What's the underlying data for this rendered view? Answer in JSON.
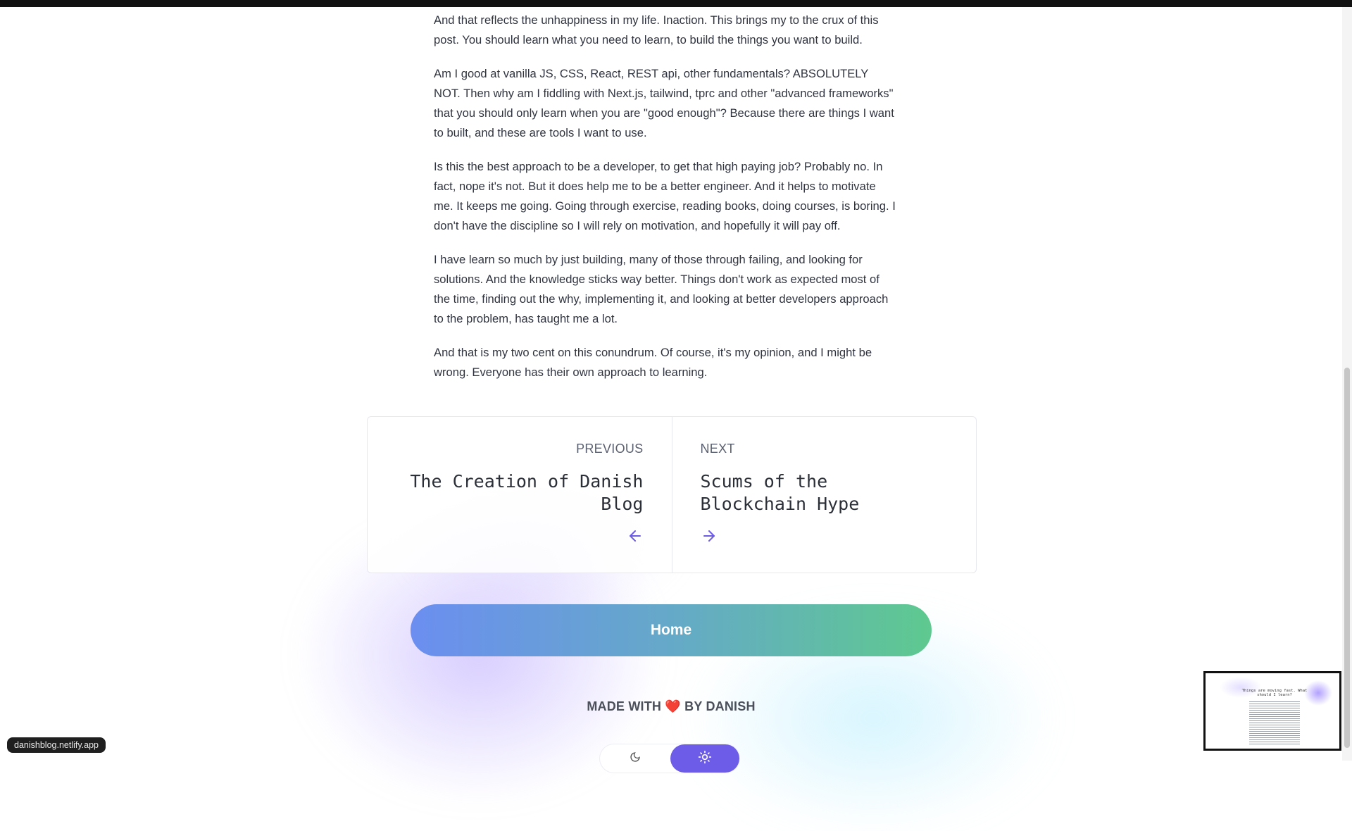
{
  "article": {
    "paragraphs": [
      "And that reflects the unhappiness in my life. Inaction. This brings my to the crux of this post. You should learn what you need to learn, to build the things you want to build.",
      "Am I good at vanilla JS, CSS, React, REST api, other fundamentals? ABSOLUTELY NOT. Then why am I fiddling with Next.js, tailwind, tprc and other \"advanced frameworks\" that you should only learn when you are \"good enough\"? Because there are things I want to built, and these are tools I want to use.",
      "Is this the best approach to be a developer, to get that high paying job? Probably no. In fact, nope it's not. But it does help me to be a better engineer. And it helps to motivate me. It keeps me going. Going through exercise, reading books, doing courses, is boring. I don't have the discipline so I will rely on motivation, and hopefully it will pay off.",
      "I have learn so much by just building, many of those through failing, and looking for solutions. And the knowledge sticks way better. Things don't work as expected most of the time, finding out the why, implementing it, and looking at better developers approach to the problem, has taught me a lot.",
      "And that is my two cent on this conundrum. Of course, it's my opinion, and I might be wrong. Everyone has their own approach to learning."
    ]
  },
  "post_nav": {
    "previous": {
      "kicker": "PREVIOUS",
      "title": "The Creation of Danish Blog",
      "icon": "arrow-left-icon"
    },
    "next": {
      "kicker": "NEXT",
      "title": "Scums of the Blockchain Hype",
      "icon": "arrow-right-icon"
    }
  },
  "home_button": {
    "label": "Home"
  },
  "footer": {
    "made_with_prefix": "MADE WITH",
    "heart": "❤️",
    "made_with_suffix": "BY DANISH"
  },
  "theme_toggle": {
    "dark_icon": "moon-icon",
    "light_icon": "sun-icon",
    "selected": "light"
  },
  "status_bar": {
    "url": "danishblog.netlify.app"
  },
  "minimap": {
    "title": "Things are moving fast. What should I learn?"
  },
  "colors": {
    "accent": "#6d5ce8",
    "arrow": "#6b5be6",
    "home_gradient_start": "#6b8ef0",
    "home_gradient_end": "#5ec98f",
    "text": "#2f3440"
  }
}
